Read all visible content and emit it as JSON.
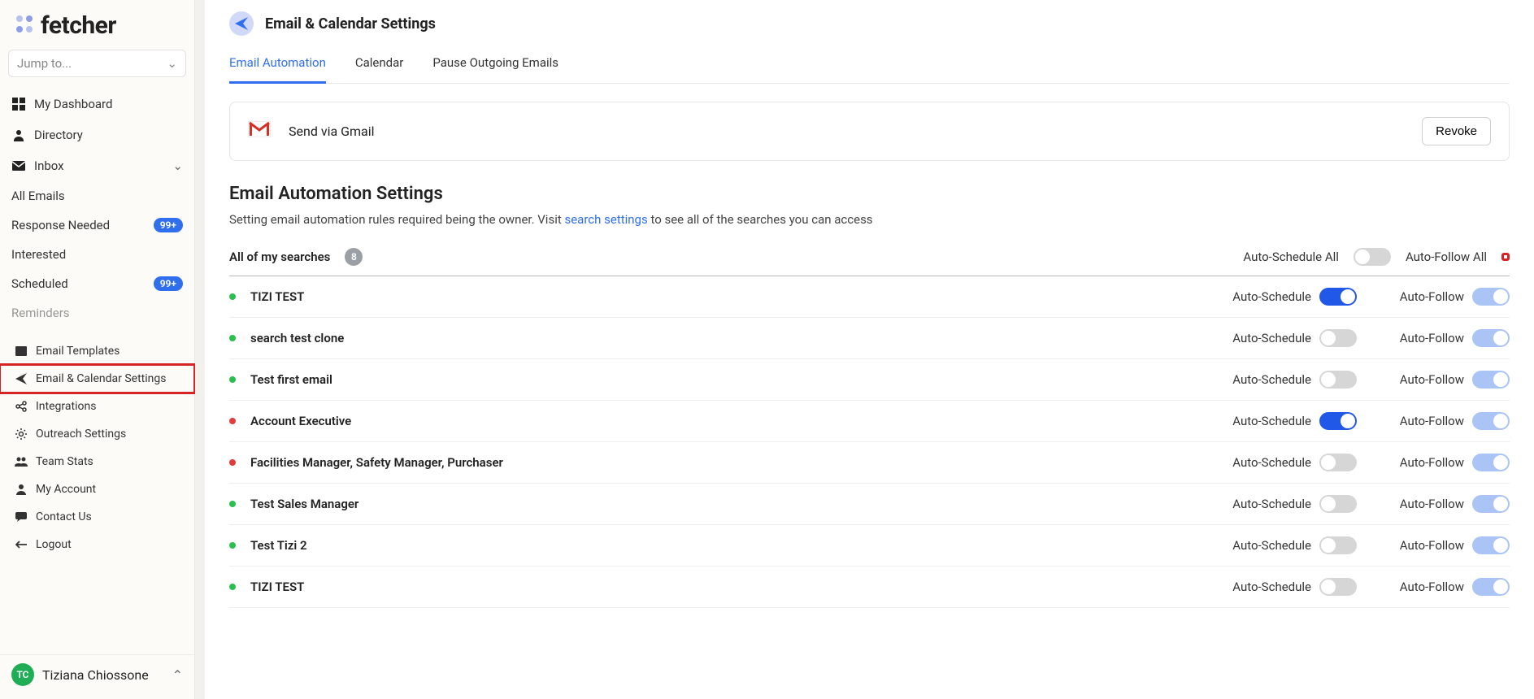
{
  "brand": "fetcher",
  "jump_placeholder": "Jump to...",
  "nav": {
    "dashboard": "My Dashboard",
    "directory": "Directory",
    "inbox": "Inbox",
    "sub_allemails": "All Emails",
    "sub_response": "Response Needed",
    "sub_interested": "Interested",
    "sub_scheduled": "Scheduled",
    "sub_reminders": "Reminders",
    "badge_99": "99+"
  },
  "settings_nav": {
    "email_templates": "Email Templates",
    "email_calendar": "Email & Calendar Settings",
    "integrations": "Integrations",
    "outreach": "Outreach Settings",
    "team_stats": "Team Stats",
    "my_account": "My Account",
    "contact_us": "Contact Us",
    "logout": "Logout"
  },
  "user": {
    "initials": "TC",
    "name": "Tiziana Chiossone"
  },
  "page": {
    "title": "Email & Calendar Settings",
    "tabs": {
      "email_automation": "Email Automation",
      "calendar": "Calendar",
      "pause_outgoing": "Pause Outgoing Emails"
    },
    "gmail_row": "Send via Gmail",
    "revoke": "Revoke",
    "section_title": "Email Automation Settings",
    "section_sub_before": "Setting email automation rules required being the owner. Visit ",
    "section_sub_link": "search settings",
    "section_sub_after": " to see all of the searches you can access",
    "all_searches_label": "All of my searches",
    "all_searches_count": "8",
    "auto_schedule_all": "Auto-Schedule All",
    "auto_follow_all": "Auto-Follow All",
    "auto_schedule": "Auto-Schedule",
    "auto_follow": "Auto-Follow"
  },
  "searches": [
    {
      "name": "TIZI TEST",
      "dot": "green",
      "sched_on": true,
      "follow_soft": true
    },
    {
      "name": "search test clone",
      "dot": "green",
      "sched_on": false,
      "follow_soft": true
    },
    {
      "name": "Test first email",
      "dot": "green",
      "sched_on": false,
      "follow_soft": true
    },
    {
      "name": "Account Executive",
      "dot": "red",
      "sched_on": true,
      "follow_soft": true
    },
    {
      "name": "Facilities Manager, Safety Manager, Purchaser",
      "dot": "red",
      "sched_on": false,
      "follow_soft": true
    },
    {
      "name": "Test Sales Manager",
      "dot": "green",
      "sched_on": false,
      "follow_soft": true
    },
    {
      "name": "Test Tizi 2",
      "dot": "green",
      "sched_on": false,
      "follow_soft": true
    },
    {
      "name": "TIZI TEST",
      "dot": "green",
      "sched_on": false,
      "follow_soft": true
    }
  ]
}
